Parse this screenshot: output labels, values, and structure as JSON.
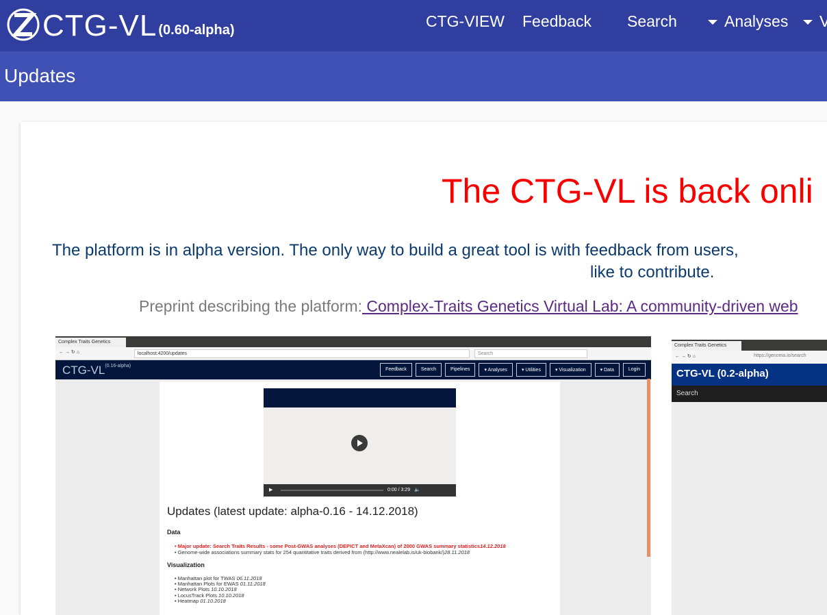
{
  "header": {
    "logo_text": "CTG-VL",
    "version": "(0.60-alpha)",
    "nav": [
      {
        "label": "CTG-VIEW"
      },
      {
        "label": "Feedback"
      },
      {
        "label": "Search"
      },
      {
        "label": "Analyses",
        "dropdown": true
      },
      {
        "label": "V",
        "dropdown": true
      }
    ]
  },
  "subheader": {
    "title": "Updates"
  },
  "main": {
    "headline": "The CTG-VL is back onli",
    "intro_line1": "The platform is in alpha version. The only way to build a great tool is with feedback from users,",
    "intro_line2": "like to contribute.",
    "preprint_label": "Preprint describing the platform:",
    "preprint_link": " Complex-Traits Genetics Virtual Lab: A community-driven web",
    "colors": {
      "headline": "#f70000",
      "intro": "#0b3a6e",
      "header": "#303f9f",
      "subheader": "#3f51b5"
    }
  },
  "screenshot1": {
    "tab_title": "Complex Traits Genetics",
    "url": "localhost:4200/updates",
    "search_placeholder": "Search",
    "logo": "CTG-VL",
    "version": "(0.16-alpha)",
    "nav": [
      "Feedback",
      "Search",
      "Pipelines",
      "▾ Analyses",
      "▾ Utilities",
      "▾ Visualization",
      "▾ Data",
      "Login"
    ],
    "video_time": "0:00 / 3:29",
    "heading": "Updates (latest update: alpha-0.16 - 14.12.2018)",
    "sections": [
      {
        "title": "Data",
        "items": [
          {
            "text": "Major update: Search Traits Results - some Post-GWAS analyses (DEPICT and MetaXcan) of 2000 GWAS summary statistics",
            "date": "14.12.2018",
            "highlight": true
          },
          {
            "text": "Genome-wide associations summary stats for 254 quantitative traits derived from (http://www.nealelab.is/uk-biobank/)",
            "date": "28.11.2018",
            "highlight": false
          }
        ]
      },
      {
        "title": "Visualization",
        "items": [
          {
            "text": "Manhattan plot for TWAS ",
            "date": "06.11.2018"
          },
          {
            "text": "Manhattan Plots for EWAS ",
            "date": "01.11.2018"
          },
          {
            "text": "Network Plots ",
            "date": "10.10.2018"
          },
          {
            "text": "LocusTrack Plots ",
            "date": "10.10.2018"
          },
          {
            "text": "Heatmap ",
            "date": "01.10.2018"
          }
        ]
      }
    ]
  },
  "screenshot2": {
    "tab_title": "Complex Traits Genetics",
    "url": "https://genoma.io/search",
    "title": "CTG-VL (0.2-alpha)",
    "subnav": "Search"
  }
}
